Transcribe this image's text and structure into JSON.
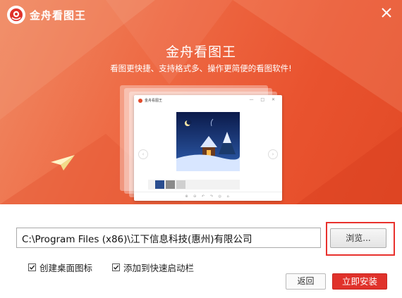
{
  "app": {
    "title": "金舟看图王"
  },
  "hero": {
    "title": "金舟看图王",
    "subtitle": "看图更快捷、支持格式多、操作更简便的看图软件!"
  },
  "preview": {
    "window_title": "金舟看图王"
  },
  "install": {
    "path_value": "C:\\Program Files (x86)\\江下信息科技(惠州)有限公司",
    "browse_label": "浏览...",
    "options": [
      {
        "label": "创建桌面图标",
        "checked": true
      },
      {
        "label": "添加到快速启动栏",
        "checked": true
      }
    ],
    "back_label": "返回",
    "install_label": "立即安装"
  },
  "colors": {
    "accent": "#e0322b",
    "banner": "#ea5a33"
  },
  "icons": {
    "close": "close-icon",
    "logo": "app-logo-icon",
    "plane": "paper-plane-icon"
  }
}
